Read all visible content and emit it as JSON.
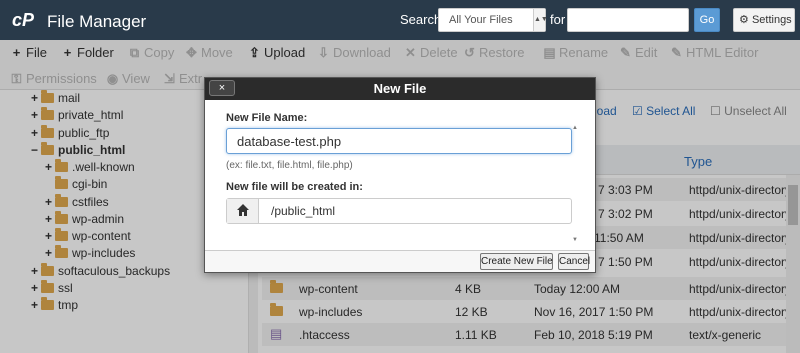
{
  "header": {
    "title": "File Manager",
    "search_label": "Search",
    "search_scope": "All Your Files",
    "for_label": "for",
    "go_label": "Go",
    "settings_label": "Settings"
  },
  "toolbar": {
    "row1": [
      {
        "label": "File",
        "icon": "plus-icon",
        "enabled": true
      },
      {
        "label": "Folder",
        "icon": "plus-icon",
        "enabled": true
      },
      {
        "label": "Copy",
        "icon": "copy-icon",
        "enabled": false
      },
      {
        "label": "Move",
        "icon": "move-icon",
        "enabled": false
      },
      {
        "label": "Upload",
        "icon": "upload-icon",
        "enabled": true
      },
      {
        "label": "Download",
        "icon": "download-icon",
        "enabled": false
      },
      {
        "label": "Delete",
        "icon": "close-icon",
        "enabled": false
      },
      {
        "label": "Restore",
        "icon": "restore-icon",
        "enabled": false
      },
      {
        "label": "Rename",
        "icon": "file-icon",
        "enabled": false
      },
      {
        "label": "Edit",
        "icon": "pencil-icon",
        "enabled": false
      },
      {
        "label": "HTML Editor",
        "icon": "html-editor-icon",
        "enabled": false
      }
    ],
    "row2": [
      {
        "label": "Permissions",
        "icon": "key-icon",
        "enabled": false
      },
      {
        "label": "View",
        "icon": "eye-icon",
        "enabled": false
      },
      {
        "label": "Extr",
        "icon": "extract-icon",
        "enabled": false
      }
    ]
  },
  "tree": [
    {
      "label": "mail",
      "toggle": "+",
      "bold": false
    },
    {
      "label": "private_html",
      "toggle": "+",
      "bold": false
    },
    {
      "label": "public_ftp",
      "toggle": "+",
      "bold": false
    },
    {
      "label": "public_html",
      "toggle": "−",
      "bold": true
    },
    {
      "label": ".well-known",
      "toggle": "+",
      "bold": false
    },
    {
      "label": "cgi-bin",
      "toggle": "",
      "bold": false
    },
    {
      "label": "cstfiles",
      "toggle": "+",
      "bold": false
    },
    {
      "label": "wp-admin",
      "toggle": "+",
      "bold": false
    },
    {
      "label": "wp-content",
      "toggle": "+",
      "bold": false
    },
    {
      "label": "wp-includes",
      "toggle": "+",
      "bold": false
    },
    {
      "label": "softaculous_backups",
      "toggle": "+",
      "bold": false
    },
    {
      "label": "ssl",
      "toggle": "+",
      "bold": false
    },
    {
      "label": "tmp",
      "toggle": "+",
      "bold": false
    }
  ],
  "selection": {
    "load_fragment": "load",
    "select_all": "Select All",
    "unselect_all": "Unselect All"
  },
  "table": {
    "type_header": "Type",
    "partial_rows": [
      {
        "modified": "7 3:03 PM",
        "type": "httpd/unix-directory"
      },
      {
        "modified": "7 3:02 PM",
        "type": "httpd/unix-directory"
      },
      {
        "modified": "11:50 AM",
        "type": "httpd/unix-directory"
      },
      {
        "modified": "7 1:50 PM",
        "type": "httpd/unix-directory"
      }
    ],
    "rows": [
      {
        "name": "wp-content",
        "size": "4 KB",
        "modified": "Today 12:00 AM",
        "type": "httpd/unix-directory",
        "kind": "folder"
      },
      {
        "name": "wp-includes",
        "size": "12 KB",
        "modified": "Nov 16, 2017 1:50 PM",
        "type": "httpd/unix-directory",
        "kind": "folder"
      },
      {
        "name": ".htaccess",
        "size": "1.11 KB",
        "modified": "Feb 10, 2018 5:19 PM",
        "type": "text/x-generic",
        "kind": "file"
      }
    ]
  },
  "dialog": {
    "title": "New File",
    "close_label": "×",
    "name_label": "New File Name:",
    "name_value": "database-test.php",
    "hint": "(ex: file.txt, file.html, file.php)",
    "location_label": "New file will be created in:",
    "location_value": "/public_html",
    "create_button": "Create New File",
    "cancel_button": "Cancel"
  },
  "colors": {
    "header_bg": "#293a4a",
    "accent": "#5b9bd5",
    "folder": "#e0a94f",
    "dialog_title_bg": "#2b2b2b"
  }
}
